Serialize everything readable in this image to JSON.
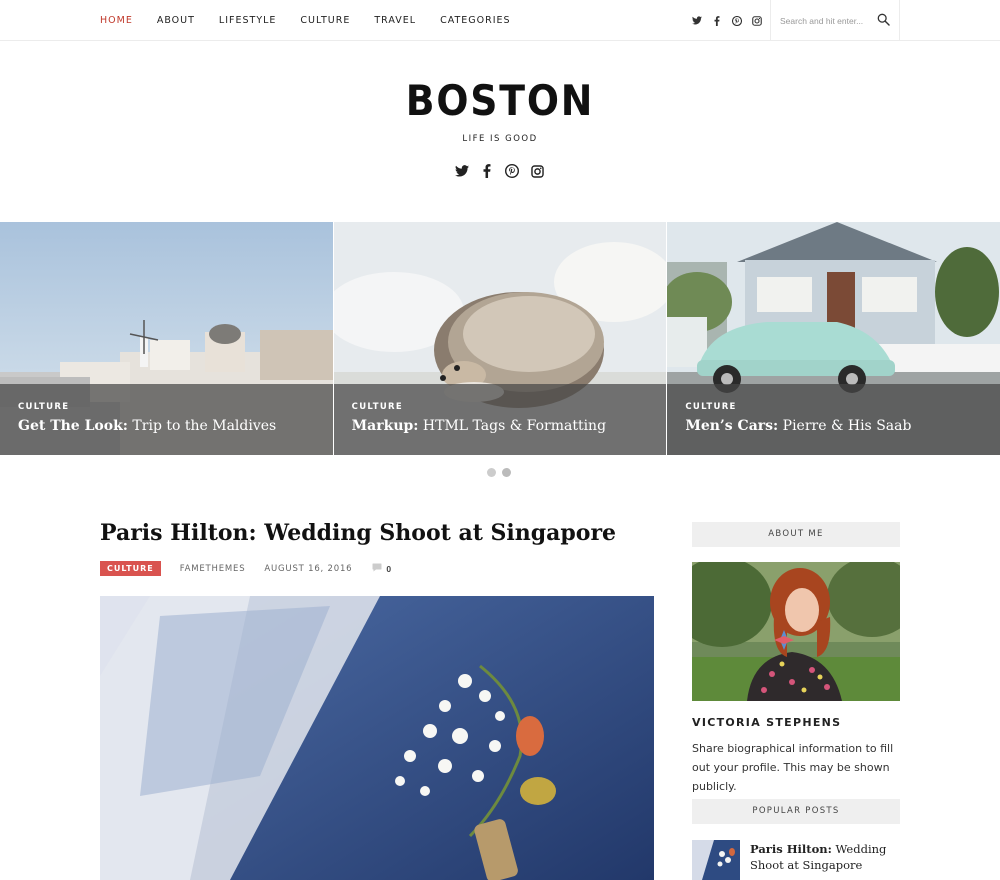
{
  "nav": {
    "items": [
      "HOME",
      "ABOUT",
      "LIFESTYLE",
      "CULTURE",
      "TRAVEL",
      "CATEGORIES"
    ],
    "active": "HOME"
  },
  "search": {
    "placeholder": "Search and hit enter..."
  },
  "brand": {
    "title": "BOSTON",
    "tagline": "LIFE IS GOOD"
  },
  "social_icons": [
    "twitter-icon",
    "facebook-icon",
    "pinterest-icon",
    "instagram-icon"
  ],
  "slides": [
    {
      "category": "CULTURE",
      "title_bold": "Get The Look:",
      "title_rest": " Trip to the Maldives"
    },
    {
      "category": "CULTURE",
      "title_bold": "Markup:",
      "title_rest": " HTML Tags & Formatting"
    },
    {
      "category": "CULTURE",
      "title_bold": "Men’s Cars:",
      "title_rest": " Pierre & His Saab"
    }
  ],
  "post": {
    "title_bold": "Paris Hilton:",
    "title_rest": " Wedding Shoot at Singapore",
    "category": "CULTURE",
    "author": "FAMETHEMES",
    "date": "AUGUST 16, 2016",
    "comments": "0"
  },
  "sidebar": {
    "about": {
      "heading": "ABOUT ME",
      "name": "VICTORIA STEPHENS",
      "bio": "Share biographical information to fill out your profile. This may be shown publicly."
    },
    "popular": {
      "heading": "POPULAR POSTS",
      "items": [
        {
          "title_bold": "Paris Hilton:",
          "title_rest": " Wedding Shoot at Singapore"
        }
      ]
    }
  },
  "colors": {
    "accent": "#c0392b",
    "badge": "#d9534f",
    "overlay": "#464646"
  }
}
